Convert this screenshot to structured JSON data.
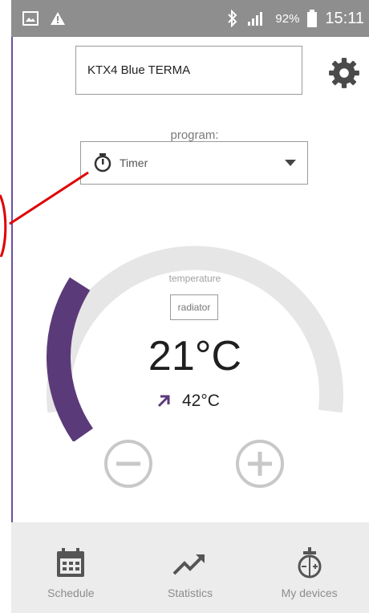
{
  "status_bar": {
    "battery": "92%",
    "time": "15:11"
  },
  "device": {
    "name": "KTX4 Blue TERMA"
  },
  "program": {
    "label": "program:",
    "selected": "Timer"
  },
  "thermostat": {
    "label": "temperature",
    "sensor": "radiator",
    "set_temperature": "21°C",
    "current_temperature": "42°C",
    "dial_fill_fraction": 0.27
  },
  "nav": {
    "items": [
      {
        "label": "Schedule",
        "icon": "calendar-icon"
      },
      {
        "label": "Statistics",
        "icon": "trend-icon"
      },
      {
        "label": "My devices",
        "icon": "device-icon"
      }
    ]
  },
  "colors": {
    "accent": "#5b3a7a",
    "track": "#e6e6e6",
    "status_bar": "#8e8e8e",
    "annotation": "#e00000"
  }
}
